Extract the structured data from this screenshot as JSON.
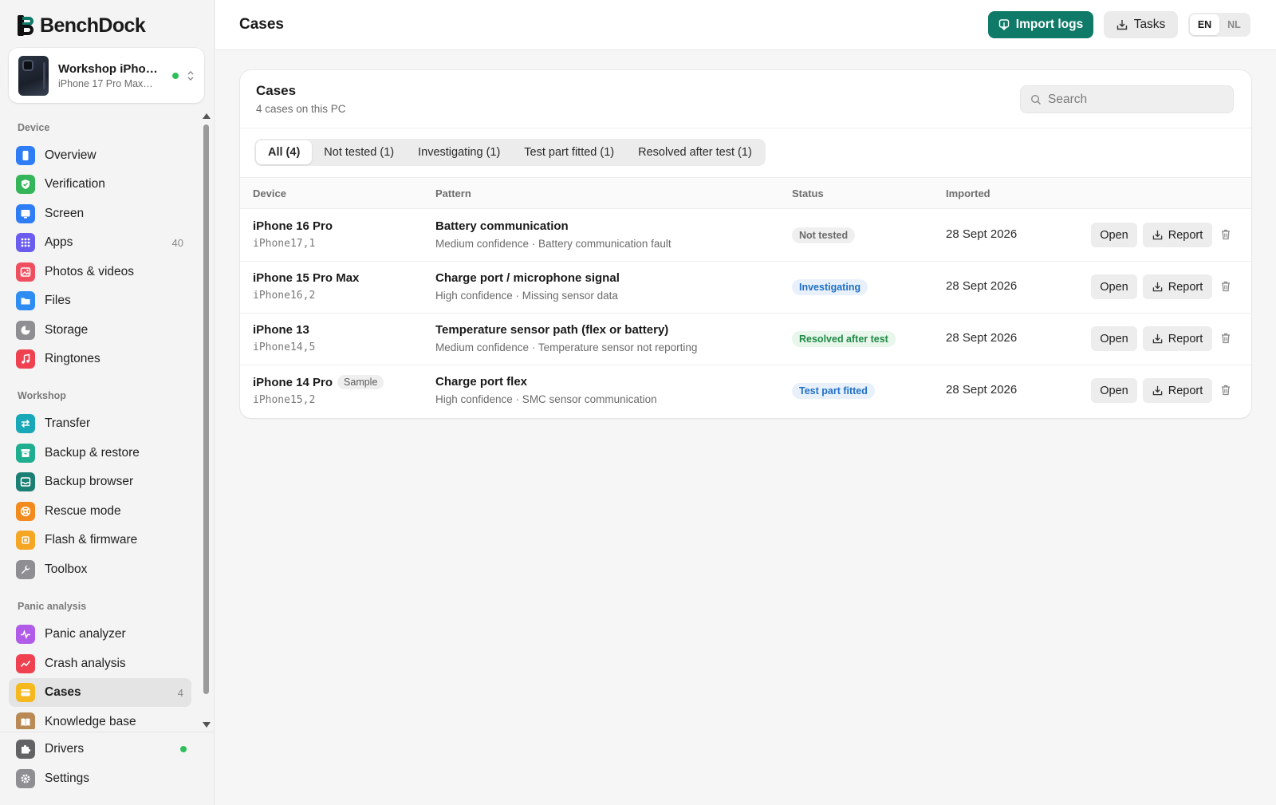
{
  "app": {
    "brand_part1": "Bench",
    "brand_part2": "Dock",
    "accent_color": "#0f7a68"
  },
  "device_card": {
    "name": "Workshop iPho…",
    "model": "iPhone 17 Pro Max…",
    "status": "connected"
  },
  "sidebar": {
    "sections": [
      {
        "label": "Device"
      },
      {
        "label": "Workshop"
      },
      {
        "label": "Panic analysis"
      }
    ],
    "items": [
      {
        "label": "Overview",
        "icon": "phone-icon",
        "color": "#2f7df6",
        "count": ""
      },
      {
        "label": "Verification",
        "icon": "shield-check-icon",
        "color": "#34b55a",
        "count": ""
      },
      {
        "label": "Screen",
        "icon": "screen-icon",
        "color": "#2f7df6",
        "count": ""
      },
      {
        "label": "Apps",
        "icon": "apps-grid-icon",
        "color": "#6b5cf0",
        "count": "40"
      },
      {
        "label": "Photos & videos",
        "icon": "photos-icon",
        "color": "#ef4f5f",
        "count": ""
      },
      {
        "label": "Files",
        "icon": "folder-icon",
        "color": "#2f8cf2",
        "count": ""
      },
      {
        "label": "Storage",
        "icon": "pie-chart-icon",
        "color": "#8e8e93",
        "count": ""
      },
      {
        "label": "Ringtones",
        "icon": "music-note-icon",
        "color": "#ef4150",
        "count": ""
      },
      {
        "label": "Transfer",
        "icon": "transfer-icon",
        "color": "#19a8b8",
        "count": ""
      },
      {
        "label": "Backup & restore",
        "icon": "archive-icon",
        "color": "#1fae8f",
        "count": ""
      },
      {
        "label": "Backup browser",
        "icon": "drawer-icon",
        "color": "#1b7f73",
        "count": ""
      },
      {
        "label": "Rescue mode",
        "icon": "lifebuoy-icon",
        "color": "#f28a1e",
        "count": ""
      },
      {
        "label": "Flash & firmware",
        "icon": "chip-icon",
        "color": "#f5a623",
        "count": ""
      },
      {
        "label": "Toolbox",
        "icon": "wrench-icon",
        "color": "#8e8e93",
        "count": ""
      },
      {
        "label": "Panic analyzer",
        "icon": "pulse-icon",
        "color": "#b05ce8",
        "count": ""
      },
      {
        "label": "Crash analysis",
        "icon": "trend-icon",
        "color": "#ef4150",
        "count": ""
      },
      {
        "label": "Cases",
        "icon": "case-folder-icon",
        "color": "#f5b81e",
        "count": "4"
      },
      {
        "label": "Knowledge base",
        "icon": "book-icon",
        "color": "#b98a56",
        "count": ""
      }
    ],
    "footer": [
      {
        "label": "Drivers",
        "icon": "puzzle-icon",
        "color": "#636366"
      },
      {
        "label": "Settings",
        "icon": "gear-icon",
        "color": "#8e8e93"
      }
    ]
  },
  "topbar": {
    "title": "Cases",
    "import_label": "Import logs",
    "tasks_label": "Tasks",
    "lang_en": "EN",
    "lang_nl": "NL",
    "lang_selected": "EN"
  },
  "panel": {
    "title": "Cases",
    "subtitle": "4 cases on this PC",
    "search_placeholder": "Search",
    "tabs": [
      {
        "label": "All (4)",
        "active": true
      },
      {
        "label": "Not tested (1)",
        "active": false
      },
      {
        "label": "Investigating (1)",
        "active": false
      },
      {
        "label": "Test part fitted (1)",
        "active": false
      },
      {
        "label": "Resolved after test (1)",
        "active": false
      }
    ],
    "columns": {
      "device": "Device",
      "pattern": "Pattern",
      "status": "Status",
      "imported": "Imported"
    },
    "open_label": "Open",
    "report_label": "Report",
    "rows": [
      {
        "device": "iPhone 16 Pro",
        "badge": "",
        "identifier": "iPhone17,1",
        "pattern_title": "Battery communication",
        "pattern_sub": "Medium confidence · Battery communication fault",
        "status": "Not tested",
        "status_color": "gray",
        "imported": "28 Sept 2026"
      },
      {
        "device": "iPhone 15 Pro Max",
        "badge": "",
        "identifier": "iPhone16,2",
        "pattern_title": "Charge port / microphone signal",
        "pattern_sub": "High confidence · Missing sensor data",
        "status": "Investigating",
        "status_color": "blue",
        "imported": "28 Sept 2026"
      },
      {
        "device": "iPhone 13",
        "badge": "",
        "identifier": "iPhone14,5",
        "pattern_title": "Temperature sensor path (flex or battery)",
        "pattern_sub": "Medium confidence · Temperature sensor not reporting",
        "status": "Resolved after test",
        "status_color": "green",
        "imported": "28 Sept 2026"
      },
      {
        "device": "iPhone 14 Pro",
        "badge": "Sample",
        "identifier": "iPhone15,2",
        "pattern_title": "Charge port flex",
        "pattern_sub": "High confidence · SMC sensor communication",
        "status": "Test part fitted",
        "status_color": "blue",
        "imported": "28 Sept 2026"
      }
    ]
  }
}
